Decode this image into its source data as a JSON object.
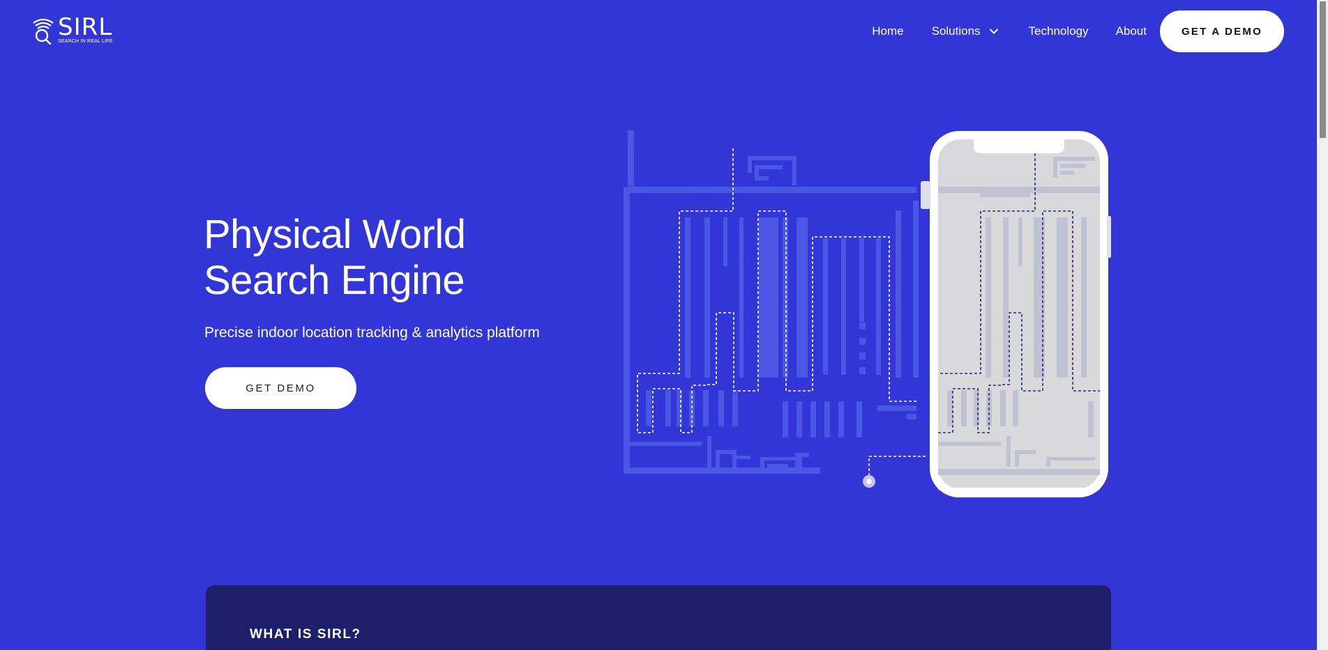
{
  "header": {
    "logo": {
      "word": "SIRL",
      "tagline": "SEARCH IN REAL LIFE"
    },
    "nav": {
      "home": "Home",
      "solutions": "Solutions",
      "technology": "Technology",
      "about": "About"
    },
    "cta_label": "GET A DEMO"
  },
  "hero": {
    "title_line1": "Physical World",
    "title_line2": "Search Engine",
    "subtitle": "Precise indoor location tracking & analytics platform",
    "cta_label": "GET DEMO"
  },
  "what_is": {
    "title": "WHAT IS SIRL?"
  },
  "colors": {
    "background": "#3336d7",
    "card": "#1e1f6b",
    "button": "#ffffff"
  },
  "icons": {
    "logo": "sirl-logo-icon",
    "solutions_dropdown": "chevron-down-icon"
  }
}
